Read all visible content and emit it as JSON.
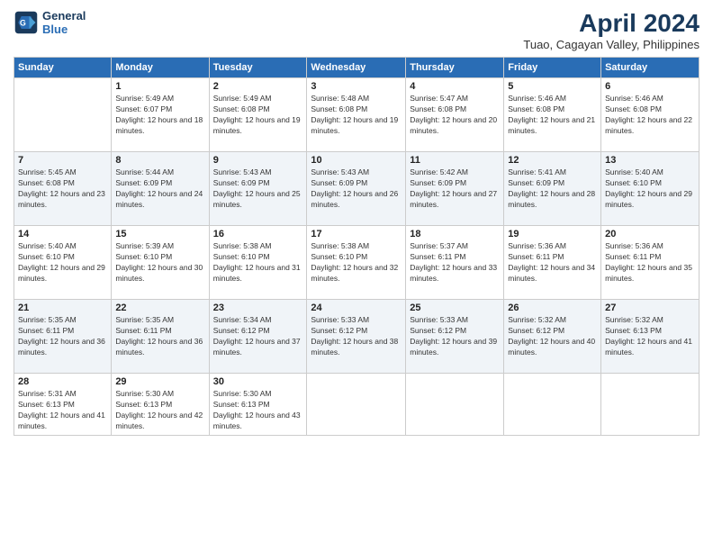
{
  "logo": {
    "line1": "General",
    "line2": "Blue"
  },
  "title": "April 2024",
  "subtitle": "Tuao, Cagayan Valley, Philippines",
  "weekdays": [
    "Sunday",
    "Monday",
    "Tuesday",
    "Wednesday",
    "Thursday",
    "Friday",
    "Saturday"
  ],
  "weeks": [
    [
      {
        "day": "",
        "sunrise": "",
        "sunset": "",
        "daylight": ""
      },
      {
        "day": "1",
        "sunrise": "Sunrise: 5:49 AM",
        "sunset": "Sunset: 6:07 PM",
        "daylight": "Daylight: 12 hours and 18 minutes."
      },
      {
        "day": "2",
        "sunrise": "Sunrise: 5:49 AM",
        "sunset": "Sunset: 6:08 PM",
        "daylight": "Daylight: 12 hours and 19 minutes."
      },
      {
        "day": "3",
        "sunrise": "Sunrise: 5:48 AM",
        "sunset": "Sunset: 6:08 PM",
        "daylight": "Daylight: 12 hours and 19 minutes."
      },
      {
        "day": "4",
        "sunrise": "Sunrise: 5:47 AM",
        "sunset": "Sunset: 6:08 PM",
        "daylight": "Daylight: 12 hours and 20 minutes."
      },
      {
        "day": "5",
        "sunrise": "Sunrise: 5:46 AM",
        "sunset": "Sunset: 6:08 PM",
        "daylight": "Daylight: 12 hours and 21 minutes."
      },
      {
        "day": "6",
        "sunrise": "Sunrise: 5:46 AM",
        "sunset": "Sunset: 6:08 PM",
        "daylight": "Daylight: 12 hours and 22 minutes."
      }
    ],
    [
      {
        "day": "7",
        "sunrise": "Sunrise: 5:45 AM",
        "sunset": "Sunset: 6:08 PM",
        "daylight": "Daylight: 12 hours and 23 minutes."
      },
      {
        "day": "8",
        "sunrise": "Sunrise: 5:44 AM",
        "sunset": "Sunset: 6:09 PM",
        "daylight": "Daylight: 12 hours and 24 minutes."
      },
      {
        "day": "9",
        "sunrise": "Sunrise: 5:43 AM",
        "sunset": "Sunset: 6:09 PM",
        "daylight": "Daylight: 12 hours and 25 minutes."
      },
      {
        "day": "10",
        "sunrise": "Sunrise: 5:43 AM",
        "sunset": "Sunset: 6:09 PM",
        "daylight": "Daylight: 12 hours and 26 minutes."
      },
      {
        "day": "11",
        "sunrise": "Sunrise: 5:42 AM",
        "sunset": "Sunset: 6:09 PM",
        "daylight": "Daylight: 12 hours and 27 minutes."
      },
      {
        "day": "12",
        "sunrise": "Sunrise: 5:41 AM",
        "sunset": "Sunset: 6:09 PM",
        "daylight": "Daylight: 12 hours and 28 minutes."
      },
      {
        "day": "13",
        "sunrise": "Sunrise: 5:40 AM",
        "sunset": "Sunset: 6:10 PM",
        "daylight": "Daylight: 12 hours and 29 minutes."
      }
    ],
    [
      {
        "day": "14",
        "sunrise": "Sunrise: 5:40 AM",
        "sunset": "Sunset: 6:10 PM",
        "daylight": "Daylight: 12 hours and 29 minutes."
      },
      {
        "day": "15",
        "sunrise": "Sunrise: 5:39 AM",
        "sunset": "Sunset: 6:10 PM",
        "daylight": "Daylight: 12 hours and 30 minutes."
      },
      {
        "day": "16",
        "sunrise": "Sunrise: 5:38 AM",
        "sunset": "Sunset: 6:10 PM",
        "daylight": "Daylight: 12 hours and 31 minutes."
      },
      {
        "day": "17",
        "sunrise": "Sunrise: 5:38 AM",
        "sunset": "Sunset: 6:10 PM",
        "daylight": "Daylight: 12 hours and 32 minutes."
      },
      {
        "day": "18",
        "sunrise": "Sunrise: 5:37 AM",
        "sunset": "Sunset: 6:11 PM",
        "daylight": "Daylight: 12 hours and 33 minutes."
      },
      {
        "day": "19",
        "sunrise": "Sunrise: 5:36 AM",
        "sunset": "Sunset: 6:11 PM",
        "daylight": "Daylight: 12 hours and 34 minutes."
      },
      {
        "day": "20",
        "sunrise": "Sunrise: 5:36 AM",
        "sunset": "Sunset: 6:11 PM",
        "daylight": "Daylight: 12 hours and 35 minutes."
      }
    ],
    [
      {
        "day": "21",
        "sunrise": "Sunrise: 5:35 AM",
        "sunset": "Sunset: 6:11 PM",
        "daylight": "Daylight: 12 hours and 36 minutes."
      },
      {
        "day": "22",
        "sunrise": "Sunrise: 5:35 AM",
        "sunset": "Sunset: 6:11 PM",
        "daylight": "Daylight: 12 hours and 36 minutes."
      },
      {
        "day": "23",
        "sunrise": "Sunrise: 5:34 AM",
        "sunset": "Sunset: 6:12 PM",
        "daylight": "Daylight: 12 hours and 37 minutes."
      },
      {
        "day": "24",
        "sunrise": "Sunrise: 5:33 AM",
        "sunset": "Sunset: 6:12 PM",
        "daylight": "Daylight: 12 hours and 38 minutes."
      },
      {
        "day": "25",
        "sunrise": "Sunrise: 5:33 AM",
        "sunset": "Sunset: 6:12 PM",
        "daylight": "Daylight: 12 hours and 39 minutes."
      },
      {
        "day": "26",
        "sunrise": "Sunrise: 5:32 AM",
        "sunset": "Sunset: 6:12 PM",
        "daylight": "Daylight: 12 hours and 40 minutes."
      },
      {
        "day": "27",
        "sunrise": "Sunrise: 5:32 AM",
        "sunset": "Sunset: 6:13 PM",
        "daylight": "Daylight: 12 hours and 41 minutes."
      }
    ],
    [
      {
        "day": "28",
        "sunrise": "Sunrise: 5:31 AM",
        "sunset": "Sunset: 6:13 PM",
        "daylight": "Daylight: 12 hours and 41 minutes."
      },
      {
        "day": "29",
        "sunrise": "Sunrise: 5:30 AM",
        "sunset": "Sunset: 6:13 PM",
        "daylight": "Daylight: 12 hours and 42 minutes."
      },
      {
        "day": "30",
        "sunrise": "Sunrise: 5:30 AM",
        "sunset": "Sunset: 6:13 PM",
        "daylight": "Daylight: 12 hours and 43 minutes."
      },
      {
        "day": "",
        "sunrise": "",
        "sunset": "",
        "daylight": ""
      },
      {
        "day": "",
        "sunrise": "",
        "sunset": "",
        "daylight": ""
      },
      {
        "day": "",
        "sunrise": "",
        "sunset": "",
        "daylight": ""
      },
      {
        "day": "",
        "sunrise": "",
        "sunset": "",
        "daylight": ""
      }
    ]
  ]
}
